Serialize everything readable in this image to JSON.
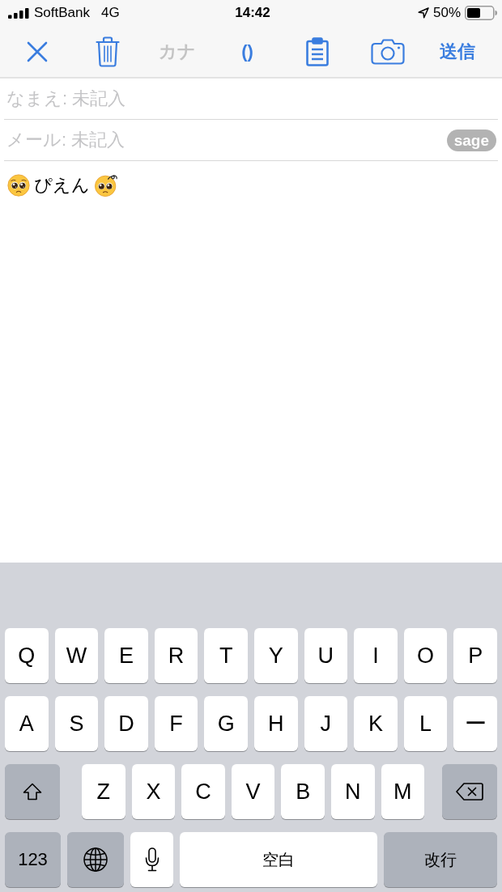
{
  "status_bar": {
    "carrier": "SoftBank",
    "network": "4G",
    "time": "14:42",
    "battery": "50%"
  },
  "toolbar": {
    "items": [
      {
        "kind": "close",
        "disabled": false
      },
      {
        "kind": "trash",
        "disabled": false
      },
      {
        "kind": "text",
        "label": "カナ",
        "disabled": true
      },
      {
        "kind": "text",
        "label": "()",
        "disabled": false
      },
      {
        "kind": "clipboard",
        "disabled": false
      },
      {
        "kind": "camera",
        "disabled": false
      },
      {
        "kind": "text",
        "label": "送信",
        "disabled": false
      }
    ]
  },
  "form": {
    "name_field": {
      "placeholder": "なまえ: 未記入"
    },
    "mail_field": {
      "placeholder": "メール: 未記入",
      "sage_button": "sage"
    },
    "message": "ぴえん"
  },
  "keyboard": {
    "rows": [
      {
        "keys": [
          {
            "kind": "letter",
            "label": "Q"
          },
          {
            "kind": "letter",
            "label": "W"
          },
          {
            "kind": "letter",
            "label": "E"
          },
          {
            "kind": "letter",
            "label": "R"
          },
          {
            "kind": "letter",
            "label": "T"
          },
          {
            "kind": "letter",
            "label": "Y"
          },
          {
            "kind": "letter",
            "label": "U"
          },
          {
            "kind": "letter",
            "label": "I"
          },
          {
            "kind": "letter",
            "label": "O"
          },
          {
            "kind": "letter",
            "label": "P"
          }
        ]
      },
      {
        "keys": [
          {
            "kind": "letter",
            "label": "A"
          },
          {
            "kind": "letter",
            "label": "S"
          },
          {
            "kind": "letter",
            "label": "D"
          },
          {
            "kind": "letter",
            "label": "F"
          },
          {
            "kind": "letter",
            "label": "G"
          },
          {
            "kind": "letter",
            "label": "H"
          },
          {
            "kind": "letter",
            "label": "J"
          },
          {
            "kind": "letter",
            "label": "K"
          },
          {
            "kind": "letter",
            "label": "L"
          },
          {
            "kind": "letter",
            "label": "ー"
          }
        ]
      },
      {
        "keys": [
          {
            "kind": "shift"
          },
          {
            "kind": "letter",
            "label": "Z"
          },
          {
            "kind": "letter",
            "label": "X"
          },
          {
            "kind": "letter",
            "label": "C"
          },
          {
            "kind": "letter",
            "label": "V"
          },
          {
            "kind": "letter",
            "label": "B"
          },
          {
            "kind": "letter",
            "label": "N"
          },
          {
            "kind": "letter",
            "label": "M"
          },
          {
            "kind": "backspace"
          }
        ]
      },
      {
        "keys": [
          {
            "kind": "number",
            "label": "123"
          },
          {
            "kind": "globe"
          },
          {
            "kind": "mic"
          },
          {
            "kind": "space",
            "label": "空白"
          },
          {
            "kind": "return",
            "label": "改行"
          }
        ]
      }
    ]
  }
}
